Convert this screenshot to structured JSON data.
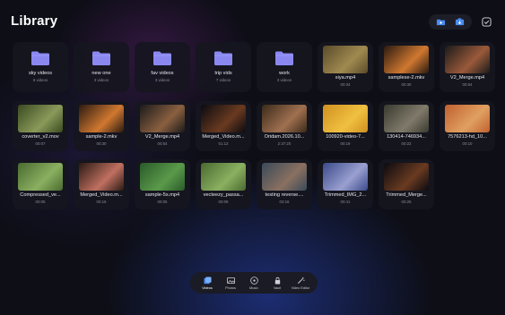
{
  "header": {
    "title": "Library"
  },
  "folders": [
    {
      "name": "sky videos",
      "meta": "6 videos"
    },
    {
      "name": "new one",
      "meta": "3 videos"
    },
    {
      "name": "fav videos",
      "meta": "3 videos"
    },
    {
      "name": "trip vids",
      "meta": "7 videos"
    },
    {
      "name": "work",
      "meta": "3 videos"
    }
  ],
  "videos": [
    {
      "name": "siya.mp4",
      "duration": "00:34",
      "colors": [
        "#5a4a2a",
        "#a08a50"
      ]
    },
    {
      "name": "samplese-2.mkv",
      "duration": "00:30",
      "colors": [
        "#2a1a10",
        "#d07830"
      ]
    },
    {
      "name": "V2_Merge.mp4",
      "duration": "00:54",
      "colors": [
        "#1a1a1a",
        "#9a5a3a"
      ]
    },
    {
      "name": "coverter_v2.mov",
      "duration": "00:07",
      "colors": [
        "#3a4a20",
        "#8a9a5a"
      ]
    },
    {
      "name": "sample-2.mkv",
      "duration": "00:30",
      "colors": [
        "#2a1a10",
        "#d07830"
      ]
    },
    {
      "name": "V2_Merge.mp4",
      "duration": "00:54",
      "colors": [
        "#1a1a1a",
        "#8a6040"
      ]
    },
    {
      "name": "Merged_Video.m...",
      "duration": "01:13",
      "colors": [
        "#0a0a10",
        "#6a3a20"
      ]
    },
    {
      "name": "Oridam.2026.10...",
      "duration": "2:37:20",
      "colors": [
        "#3a2a1a",
        "#a07050"
      ]
    },
    {
      "name": "100920-video-7...",
      "duration": "00:19",
      "colors": [
        "#d09020",
        "#f0c040"
      ]
    },
    {
      "name": "130414-746934...",
      "duration": "00:22",
      "colors": [
        "#3a3a30",
        "#807a6a"
      ]
    },
    {
      "name": "7576213-hd_10...",
      "duration": "00:10",
      "colors": [
        "#c06030",
        "#e0a060"
      ]
    },
    {
      "name": "Compressed_ve...",
      "duration": "00:05",
      "colors": [
        "#4a6a30",
        "#8ab060"
      ]
    },
    {
      "name": "Merged_Video.m...",
      "duration": "00:16",
      "colors": [
        "#2a1a14",
        "#c07060"
      ]
    },
    {
      "name": "sample-5s.mp4",
      "duration": "00:05",
      "colors": [
        "#2a5a2a",
        "#5a9a4a"
      ]
    },
    {
      "name": "vecteezy_passa...",
      "duration": "00:09",
      "colors": [
        "#4a6a30",
        "#8ab060"
      ]
    },
    {
      "name": "testing reverse....",
      "duration": "03:16",
      "colors": [
        "#3a4a5a",
        "#8a7060"
      ]
    },
    {
      "name": "Trimmed_IMG_2...",
      "duration": "00:41",
      "colors": [
        "#3a4a8a",
        "#9aa0d0"
      ]
    },
    {
      "name": "Trimmed_Merge...",
      "duration": "00:25",
      "colors": [
        "#0a0a10",
        "#6a3a20"
      ]
    }
  ],
  "dock": [
    {
      "label": "Videos",
      "icon": "videos-icon",
      "active": true
    },
    {
      "label": "Photos",
      "icon": "photos-icon",
      "active": false
    },
    {
      "label": "Music",
      "icon": "music-icon",
      "active": false
    },
    {
      "label": "Vault",
      "icon": "vault-icon",
      "active": false
    },
    {
      "label": "Video Editor",
      "icon": "video-editor-icon",
      "active": false
    }
  ],
  "colors": {
    "folder": "#8a88f0",
    "accent": "#4a8cf0",
    "tile": "#16161f"
  }
}
